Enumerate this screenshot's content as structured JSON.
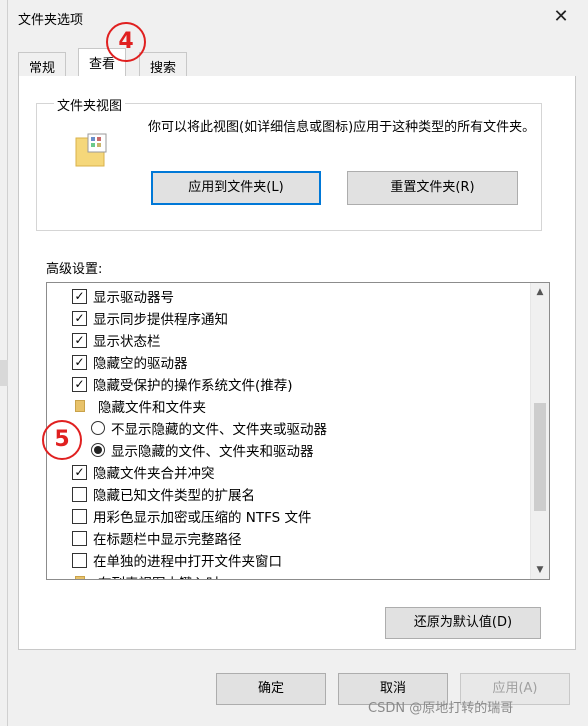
{
  "dialog": {
    "title": "文件夹选项",
    "close_symbol": "✕"
  },
  "tabs": [
    {
      "label": "常规"
    },
    {
      "label": "查看"
    },
    {
      "label": "搜索"
    }
  ],
  "folder_view": {
    "legend": "文件夹视图",
    "description": "你可以将此视图(如详细信息或图标)应用于这种类型的所有文件夹。",
    "apply_button": "应用到文件夹(L)",
    "reset_button": "重置文件夹(R)"
  },
  "advanced": {
    "label": "高级设置:",
    "items": [
      {
        "type": "checkbox",
        "checked": true,
        "text": "显示驱动器号"
      },
      {
        "type": "checkbox",
        "checked": true,
        "text": "显示同步提供程序通知"
      },
      {
        "type": "checkbox",
        "checked": true,
        "text": "显示状态栏"
      },
      {
        "type": "checkbox",
        "checked": true,
        "text": "隐藏空的驱动器"
      },
      {
        "type": "checkbox",
        "checked": true,
        "text": "隐藏受保护的操作系统文件(推荐)"
      },
      {
        "type": "folder",
        "text": "隐藏文件和文件夹"
      },
      {
        "type": "radio",
        "selected": false,
        "text": "不显示隐藏的文件、文件夹或驱动器"
      },
      {
        "type": "radio",
        "selected": true,
        "text": "显示隐藏的文件、文件夹和驱动器"
      },
      {
        "type": "checkbox",
        "checked": true,
        "text": "隐藏文件夹合并冲突"
      },
      {
        "type": "checkbox",
        "checked": false,
        "text": "隐藏已知文件类型的扩展名"
      },
      {
        "type": "checkbox",
        "checked": false,
        "text": "用彩色显示加密或压缩的 NTFS 文件"
      },
      {
        "type": "checkbox",
        "checked": false,
        "text": "在标题栏中显示完整路径"
      },
      {
        "type": "checkbox",
        "checked": false,
        "text": "在单独的进程中打开文件夹窗口"
      },
      {
        "type": "folder",
        "text": "在列表视图中键入时"
      }
    ],
    "restore_button": "还原为默认值(D)"
  },
  "footer": {
    "ok": "确定",
    "cancel": "取消",
    "apply": "应用(A)"
  },
  "annotations": {
    "step4": "4",
    "step5": "5",
    "color": "#e02020"
  },
  "watermark": "CSDN @原地打转的瑞哥",
  "icons": {
    "checkmark": "✓",
    "scroll_up": "▲",
    "scroll_down": "▼"
  }
}
